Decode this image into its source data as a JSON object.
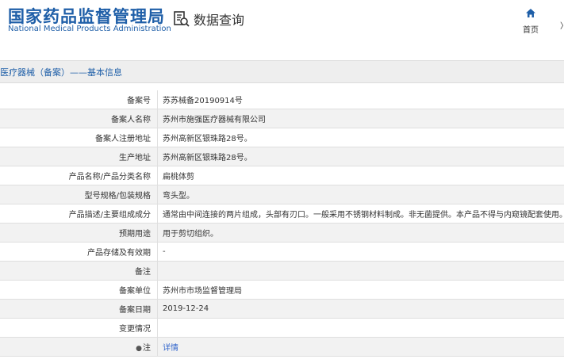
{
  "header": {
    "logo_cn": "国家药品监督管理局",
    "logo_en": "National Medical Products Administration",
    "query_label": "数据查询",
    "home_label": "首页",
    "edge_text": "〉",
    "brand_color": "#1f5fa8"
  },
  "section": {
    "title": "医疗器械（备案）——基本信息"
  },
  "rows": [
    {
      "label": "备案号",
      "value": "苏苏械备20190914号"
    },
    {
      "label": "备案人名称",
      "value": "苏州市施强医疗器械有限公司"
    },
    {
      "label": "备案人注册地址",
      "value": "苏州高新区银珠路28号。"
    },
    {
      "label": "生产地址",
      "value": "苏州高新区银珠路28号。"
    },
    {
      "label": "产品名称/产品分类名称",
      "value": "扁桃体剪"
    },
    {
      "label": "型号规格/包装规格",
      "value": "弯头型。"
    },
    {
      "label": "产品描述/主要组成成分",
      "value": "通常由中间连接的两片组成，头部有刃口。一般采用不锈钢材料制成。非无菌提供。本产品不得与内窥镜配套使用。"
    },
    {
      "label": "预期用途",
      "value": "用于剪切组织。"
    },
    {
      "label": "产品存储及有效期",
      "value": "-"
    },
    {
      "label": "备注",
      "value": ""
    },
    {
      "label": "备案单位",
      "value": "苏州市市场监督管理局"
    },
    {
      "label": "备案日期",
      "value": "2019-12-24"
    },
    {
      "label": "变更情况",
      "value": ""
    },
    {
      "label": "注",
      "value": "详情",
      "icon": "bulb-icon",
      "link": true
    }
  ]
}
